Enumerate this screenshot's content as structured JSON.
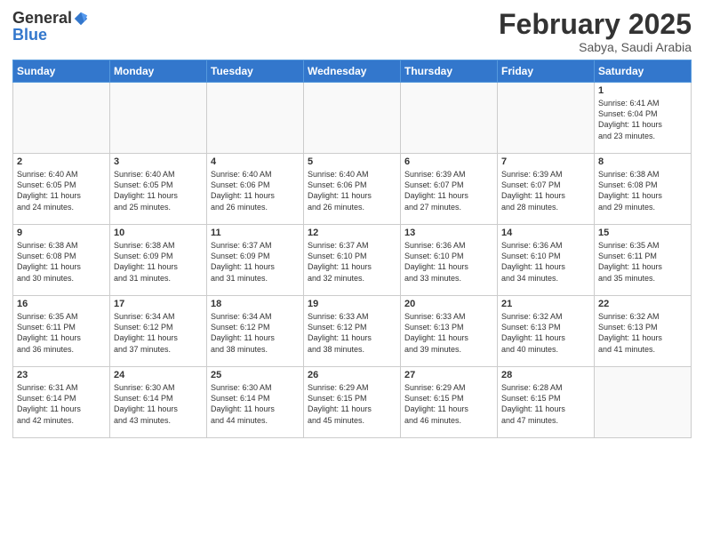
{
  "logo": {
    "general": "General",
    "blue": "Blue"
  },
  "title": "February 2025",
  "location": "Sabya, Saudi Arabia",
  "days_of_week": [
    "Sunday",
    "Monday",
    "Tuesday",
    "Wednesday",
    "Thursday",
    "Friday",
    "Saturday"
  ],
  "weeks": [
    [
      {
        "day": "",
        "info": ""
      },
      {
        "day": "",
        "info": ""
      },
      {
        "day": "",
        "info": ""
      },
      {
        "day": "",
        "info": ""
      },
      {
        "day": "",
        "info": ""
      },
      {
        "day": "",
        "info": ""
      },
      {
        "day": "1",
        "info": "Sunrise: 6:41 AM\nSunset: 6:04 PM\nDaylight: 11 hours\nand 23 minutes."
      }
    ],
    [
      {
        "day": "2",
        "info": "Sunrise: 6:40 AM\nSunset: 6:05 PM\nDaylight: 11 hours\nand 24 minutes."
      },
      {
        "day": "3",
        "info": "Sunrise: 6:40 AM\nSunset: 6:05 PM\nDaylight: 11 hours\nand 25 minutes."
      },
      {
        "day": "4",
        "info": "Sunrise: 6:40 AM\nSunset: 6:06 PM\nDaylight: 11 hours\nand 26 minutes."
      },
      {
        "day": "5",
        "info": "Sunrise: 6:40 AM\nSunset: 6:06 PM\nDaylight: 11 hours\nand 26 minutes."
      },
      {
        "day": "6",
        "info": "Sunrise: 6:39 AM\nSunset: 6:07 PM\nDaylight: 11 hours\nand 27 minutes."
      },
      {
        "day": "7",
        "info": "Sunrise: 6:39 AM\nSunset: 6:07 PM\nDaylight: 11 hours\nand 28 minutes."
      },
      {
        "day": "8",
        "info": "Sunrise: 6:38 AM\nSunset: 6:08 PM\nDaylight: 11 hours\nand 29 minutes."
      }
    ],
    [
      {
        "day": "9",
        "info": "Sunrise: 6:38 AM\nSunset: 6:08 PM\nDaylight: 11 hours\nand 30 minutes."
      },
      {
        "day": "10",
        "info": "Sunrise: 6:38 AM\nSunset: 6:09 PM\nDaylight: 11 hours\nand 31 minutes."
      },
      {
        "day": "11",
        "info": "Sunrise: 6:37 AM\nSunset: 6:09 PM\nDaylight: 11 hours\nand 31 minutes."
      },
      {
        "day": "12",
        "info": "Sunrise: 6:37 AM\nSunset: 6:10 PM\nDaylight: 11 hours\nand 32 minutes."
      },
      {
        "day": "13",
        "info": "Sunrise: 6:36 AM\nSunset: 6:10 PM\nDaylight: 11 hours\nand 33 minutes."
      },
      {
        "day": "14",
        "info": "Sunrise: 6:36 AM\nSunset: 6:10 PM\nDaylight: 11 hours\nand 34 minutes."
      },
      {
        "day": "15",
        "info": "Sunrise: 6:35 AM\nSunset: 6:11 PM\nDaylight: 11 hours\nand 35 minutes."
      }
    ],
    [
      {
        "day": "16",
        "info": "Sunrise: 6:35 AM\nSunset: 6:11 PM\nDaylight: 11 hours\nand 36 minutes."
      },
      {
        "day": "17",
        "info": "Sunrise: 6:34 AM\nSunset: 6:12 PM\nDaylight: 11 hours\nand 37 minutes."
      },
      {
        "day": "18",
        "info": "Sunrise: 6:34 AM\nSunset: 6:12 PM\nDaylight: 11 hours\nand 38 minutes."
      },
      {
        "day": "19",
        "info": "Sunrise: 6:33 AM\nSunset: 6:12 PM\nDaylight: 11 hours\nand 38 minutes."
      },
      {
        "day": "20",
        "info": "Sunrise: 6:33 AM\nSunset: 6:13 PM\nDaylight: 11 hours\nand 39 minutes."
      },
      {
        "day": "21",
        "info": "Sunrise: 6:32 AM\nSunset: 6:13 PM\nDaylight: 11 hours\nand 40 minutes."
      },
      {
        "day": "22",
        "info": "Sunrise: 6:32 AM\nSunset: 6:13 PM\nDaylight: 11 hours\nand 41 minutes."
      }
    ],
    [
      {
        "day": "23",
        "info": "Sunrise: 6:31 AM\nSunset: 6:14 PM\nDaylight: 11 hours\nand 42 minutes."
      },
      {
        "day": "24",
        "info": "Sunrise: 6:30 AM\nSunset: 6:14 PM\nDaylight: 11 hours\nand 43 minutes."
      },
      {
        "day": "25",
        "info": "Sunrise: 6:30 AM\nSunset: 6:14 PM\nDaylight: 11 hours\nand 44 minutes."
      },
      {
        "day": "26",
        "info": "Sunrise: 6:29 AM\nSunset: 6:15 PM\nDaylight: 11 hours\nand 45 minutes."
      },
      {
        "day": "27",
        "info": "Sunrise: 6:29 AM\nSunset: 6:15 PM\nDaylight: 11 hours\nand 46 minutes."
      },
      {
        "day": "28",
        "info": "Sunrise: 6:28 AM\nSunset: 6:15 PM\nDaylight: 11 hours\nand 47 minutes."
      },
      {
        "day": "",
        "info": ""
      }
    ]
  ]
}
